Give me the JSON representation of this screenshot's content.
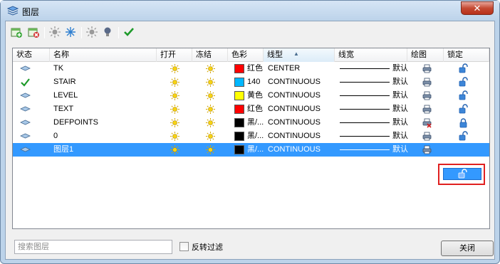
{
  "window": {
    "title": "图层",
    "close_glyph": "✕"
  },
  "toolbar": {
    "icons": [
      "new-layer-icon",
      "delete-layer-icon",
      "sun-icon",
      "snowflake-icon",
      "sun-icon",
      "bulb-icon",
      "apply-check-icon"
    ]
  },
  "table": {
    "headers": {
      "status": "状态",
      "name": "名称",
      "on": "打开",
      "freeze": "冻结",
      "color": "色彩",
      "linetype": "线型",
      "lineweight": "线宽",
      "plot": "绘图",
      "lock": "锁定"
    },
    "rows": [
      {
        "status": "layer",
        "name": "TK",
        "color_hex": "#ff0000",
        "color": "红色",
        "linetype": "CENTER",
        "lineweight": "默认",
        "plot": "printer",
        "lock": "unlocked"
      },
      {
        "status": "current",
        "name": "STAIR",
        "color_hex": "#00b7ff",
        "color": "140",
        "linetype": "CONTINUOUS",
        "lineweight": "默认",
        "plot": "printer",
        "lock": "unlocked"
      },
      {
        "status": "layer",
        "name": "LEVEL",
        "color_hex": "#ffff00",
        "color": "黄色",
        "linetype": "CONTINUOUS",
        "lineweight": "默认",
        "plot": "printer",
        "lock": "unlocked"
      },
      {
        "status": "layer",
        "name": "TEXT",
        "color_hex": "#ff0000",
        "color": "红色",
        "linetype": "CONTINUOUS",
        "lineweight": "默认",
        "plot": "printer",
        "lock": "unlocked"
      },
      {
        "status": "layer",
        "name": "DEFPOINTS",
        "color_hex": "#000000",
        "color": "黑/...",
        "linetype": "CONTINUOUS",
        "lineweight": "默认",
        "plot": "no-plot",
        "lock": "locked"
      },
      {
        "status": "layer",
        "name": "0",
        "color_hex": "#000000",
        "color": "黑/...",
        "linetype": "CONTINUOUS",
        "lineweight": "默认",
        "plot": "printer",
        "lock": "unlocked"
      },
      {
        "status": "layer",
        "name": "图层1",
        "color_hex": "#000000",
        "color": "黑/...",
        "linetype": "CONTINUOUS",
        "lineweight": "默认",
        "plot": "printer",
        "lock": "unlocked",
        "selected": true
      }
    ]
  },
  "bottom": {
    "search_placeholder": "搜索图层",
    "invert_filter_label": "反转过滤",
    "invert_filter_checked": false,
    "close_label": "关闭"
  },
  "colors": {
    "selection": "#3399ff",
    "highlight_box": "#e02020",
    "window_frame": "#bcd3ea"
  }
}
